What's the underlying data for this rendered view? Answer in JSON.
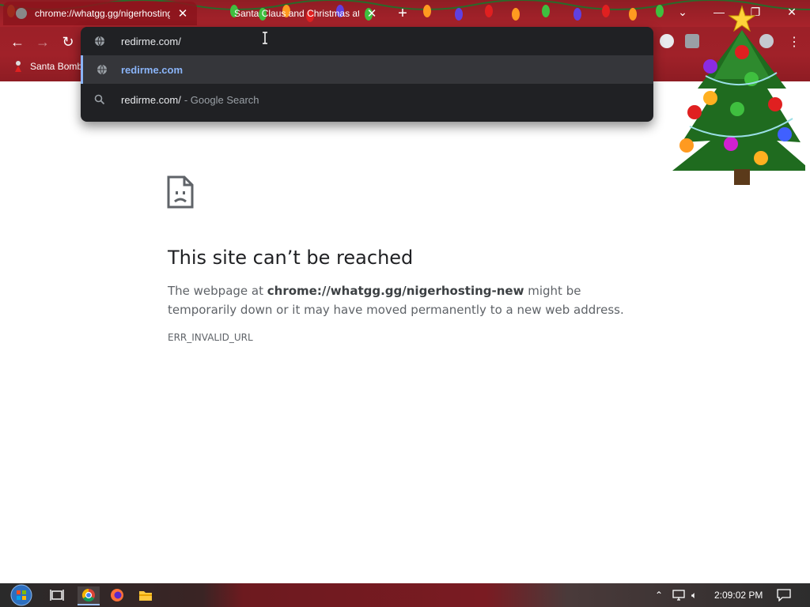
{
  "tabs": [
    {
      "title": "chrome://whatgg.gg/nigerhosting-new",
      "active": true
    },
    {
      "title": "Santa Claus and Christmas at the",
      "active": false
    }
  ],
  "window_controls": {
    "minimize": "—",
    "maximize": "❐",
    "close": "✕"
  },
  "omnibox": {
    "input_value": "redirme.com/",
    "suggestions": [
      {
        "primary": "redirme.com",
        "secondary": "",
        "icon": "globe-icon",
        "selected": true
      },
      {
        "primary": "redirme.com/",
        "secondary": "- Google Search",
        "icon": "search-icon",
        "selected": false
      }
    ]
  },
  "bookmarks": [
    {
      "label": "Santa Bomb"
    }
  ],
  "error_page": {
    "title": "This site can’t be reached",
    "desc_prefix": "The webpage at ",
    "desc_url": "chrome://whatgg.gg/nigerhosting-new",
    "desc_suffix": " might be temporarily down or it may have moved permanently to a new web address.",
    "code": "ERR_INVALID_URL"
  },
  "taskbar": {
    "clock": "2:09:02 PM"
  },
  "colors": {
    "chrome_red": "#a02129",
    "omnibox_bg": "#202124",
    "link_blue": "#8ab4f8"
  }
}
